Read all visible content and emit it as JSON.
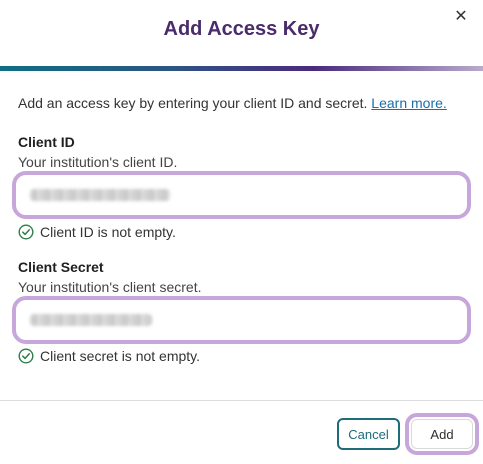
{
  "dialog": {
    "title": "Add Access Key",
    "close_glyph": "✕",
    "intro_text": "Add an access key by entering your client ID and secret. ",
    "learn_more": "Learn more."
  },
  "client_id": {
    "label": "Client ID",
    "help": "Your institution's client ID.",
    "value": "••••••••••••••",
    "validation": "Client ID is not empty."
  },
  "client_secret": {
    "label": "Client Secret",
    "help": "Your institution's client secret.",
    "value": "••••••••••••",
    "validation": "Client secret is not empty."
  },
  "footer": {
    "cancel_label": "Cancel",
    "add_label": "Add"
  },
  "colors": {
    "title": "#4a2b6b",
    "focus_ring": "#c7a6dc",
    "link": "#1a6fa8",
    "cancel_border": "#1e6b7a",
    "success": "#2e7d4a"
  },
  "icons": {
    "close": "close-icon",
    "check": "check-circle-icon"
  }
}
